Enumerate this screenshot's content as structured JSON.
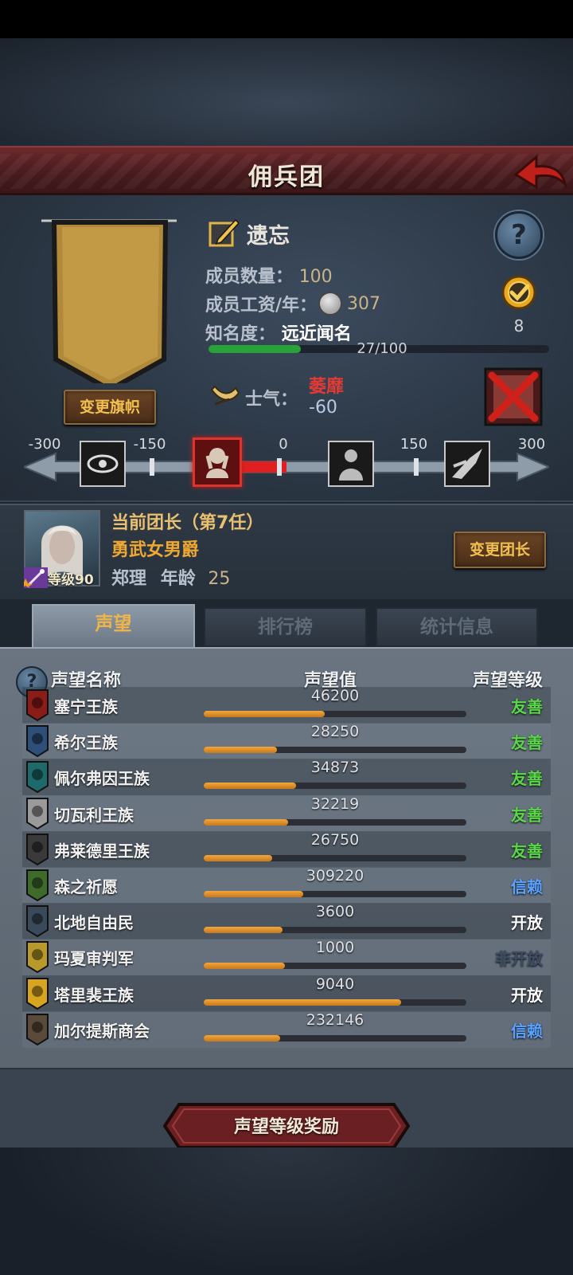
{
  "header": {
    "title": "佣兵团",
    "back_icon": "back-arrow-icon"
  },
  "guild": {
    "name": "遗忘",
    "change_banner_label": "变更旗帜",
    "members_label": "成员数量：",
    "members_value": "100",
    "wage_label": "成员工资/年：",
    "wage_value": "307",
    "fame_label": "知名度：",
    "fame_state": "远近闻名",
    "fame_progress": "27/100",
    "fame_fraction": 0.27,
    "achievement_count": "8",
    "morale_label": "士气：",
    "morale_state": "萎靡",
    "morale_value": "-60"
  },
  "morale_track": {
    "ticks": [
      "-300",
      "-150",
      "0",
      "150",
      "300"
    ],
    "current": -60,
    "range": [
      -300,
      300
    ]
  },
  "leader": {
    "title": "当前团长（第7任）",
    "trait": "勇武女男爵",
    "level": "等级90",
    "name": "郑理",
    "age_label": "年龄",
    "age": "25",
    "change_label": "变更团长"
  },
  "tabs": [
    {
      "label": "声望"
    },
    {
      "label": "排行榜"
    },
    {
      "label": "统计信息"
    }
  ],
  "reputation": {
    "col_name": "声望名称",
    "col_value": "声望值",
    "col_level": "声望等级",
    "rows": [
      {
        "name": "塞宁王族",
        "value": "46200",
        "fraction": 0.46,
        "level": "友善",
        "color": "#5ad84a",
        "crest": "#8a1d18"
      },
      {
        "name": "希尔王族",
        "value": "28250",
        "fraction": 0.28,
        "level": "友善",
        "color": "#5ad84a",
        "crest": "#2d4f7a"
      },
      {
        "name": "佩尔弗因王族",
        "value": "34873",
        "fraction": 0.35,
        "level": "友善",
        "color": "#5ad84a",
        "crest": "#1e6a6a"
      },
      {
        "name": "切瓦利王族",
        "value": "32219",
        "fraction": 0.32,
        "level": "友善",
        "color": "#5ad84a",
        "crest": "#9a9a9a"
      },
      {
        "name": "弗莱德里王族",
        "value": "26750",
        "fraction": 0.26,
        "level": "友善",
        "color": "#5ad84a",
        "crest": "#3a3a3a"
      },
      {
        "name": "森之祈愿",
        "value": "309220",
        "fraction": 0.38,
        "level": "信赖",
        "color": "#5aa2ff",
        "crest": "#3e6a2a"
      },
      {
        "name": "北地自由民",
        "value": "3600",
        "fraction": 0.3,
        "level": "开放",
        "color": "#ffffff",
        "crest": "#3b4a5a"
      },
      {
        "name": "玛夏审判军",
        "value": "1000",
        "fraction": 0.31,
        "level": "非开放",
        "color": "#3b4c63",
        "crest": "#b89a2a"
      },
      {
        "name": "塔里裴王族",
        "value": "9040",
        "fraction": 0.75,
        "level": "开放",
        "color": "#ffffff",
        "crest": "#d8a520"
      },
      {
        "name": "加尔提斯商会",
        "value": "232146",
        "fraction": 0.29,
        "level": "信赖",
        "color": "#5aa2ff",
        "crest": "#5a4a3a"
      }
    ]
  },
  "reward_button_label": "声望等级奖励"
}
